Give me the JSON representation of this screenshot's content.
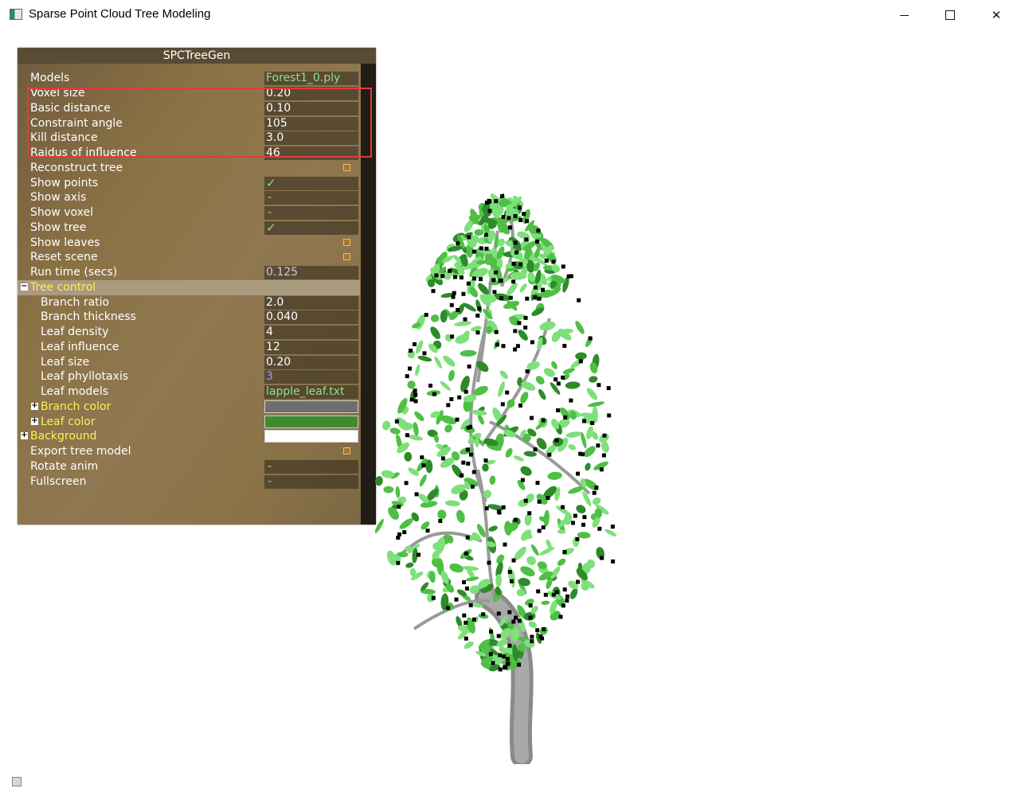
{
  "window": {
    "title": "Sparse Point Cloud Tree Modeling"
  },
  "panel": {
    "title": "SPCTreeGen",
    "rows": {
      "models": {
        "label": "Models",
        "value": "Forest1_0.ply"
      },
      "voxel_size": {
        "label": "Voxel size",
        "value": "0.20"
      },
      "basic_distance": {
        "label": "Basic distance",
        "value": "0.10"
      },
      "constraint_angle": {
        "label": "Constraint angle",
        "value": "105"
      },
      "kill_distance": {
        "label": "Kill distance",
        "value": "3.0"
      },
      "radius_influence": {
        "label": "Raidus of influence",
        "value": "46"
      },
      "reconstruct_tree": {
        "label": "Reconstruct tree"
      },
      "show_points": {
        "label": "Show points",
        "value": "✓"
      },
      "show_axis": {
        "label": "Show axis",
        "value": "-"
      },
      "show_voxel": {
        "label": "Show voxel",
        "value": "-"
      },
      "show_tree": {
        "label": "Show tree",
        "value": "✓"
      },
      "show_leaves": {
        "label": "Show leaves"
      },
      "reset_scene": {
        "label": "Reset scene"
      },
      "run_time": {
        "label": "Run time (secs)",
        "value": "0.125"
      },
      "tree_control": {
        "label": "Tree control",
        "toggle": "−"
      },
      "branch_ratio": {
        "label": "Branch ratio",
        "value": "2.0"
      },
      "branch_thickness": {
        "label": "Branch thickness",
        "value": "0.040"
      },
      "leaf_density": {
        "label": "Leaf density",
        "value": "4"
      },
      "leaf_influence": {
        "label": "Leaf influence",
        "value": "12"
      },
      "leaf_size": {
        "label": "Leaf size",
        "value": "0.20"
      },
      "leaf_phyllotaxis": {
        "label": "Leaf phyllotaxis",
        "value": "3"
      },
      "leaf_models": {
        "label": "Leaf models",
        "value": "lapple_leaf.txt"
      },
      "branch_color": {
        "label": "Branch color",
        "toggle": "+",
        "color": "#6e6e6e"
      },
      "leaf_color": {
        "label": "Leaf color",
        "toggle": "+",
        "color": "#3f8a2f"
      },
      "background": {
        "label": "Background",
        "toggle": "+",
        "color": "#ffffff"
      },
      "export_tree_model": {
        "label": "Export tree model"
      },
      "rotate_anim": {
        "label": "Rotate anim",
        "value": "-"
      },
      "fullscreen": {
        "label": "Fullscreen",
        "value": "-"
      }
    }
  },
  "colors": {
    "panel_bg": "#8b7245",
    "highlight": "#e33a3a",
    "leaf_light": "#7ee07a",
    "leaf_mid": "#4fbf46",
    "trunk": "#a9a9a9",
    "points": "#000000"
  }
}
